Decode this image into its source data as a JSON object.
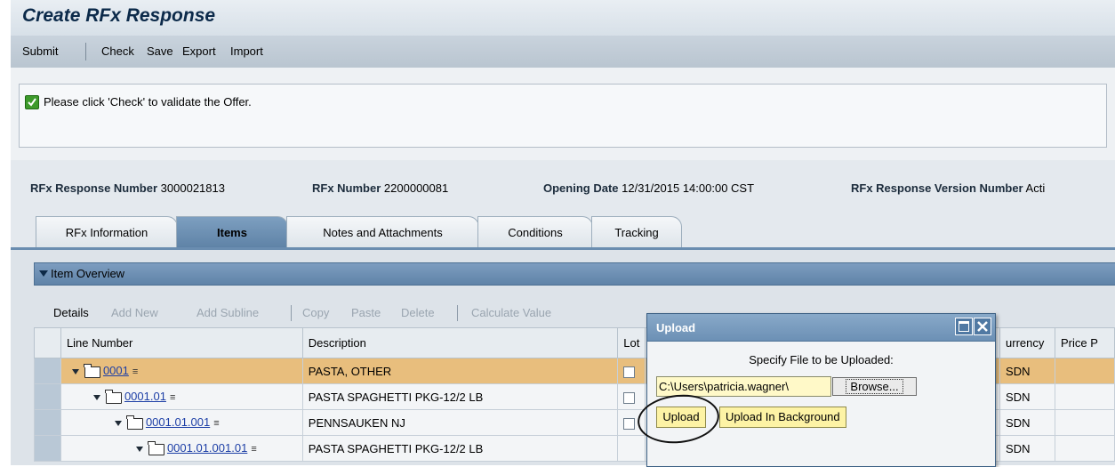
{
  "page_title": "Create RFx Response",
  "toolbar": {
    "submit": "Submit",
    "check": "Check",
    "save": "Save",
    "export": "Export",
    "import": "Import"
  },
  "message": "Please click 'Check' to validate the Offer.",
  "header": {
    "rfx_response_number_label": "RFx Response Number",
    "rfx_response_number": "3000021813",
    "rfx_number_label": "RFx Number",
    "rfx_number": "2200000081",
    "opening_date_label": "Opening Date",
    "opening_date": "12/31/2015 14:00:00 CST",
    "version_label": "RFx Response Version Number",
    "version_value": "Acti"
  },
  "tabs": [
    {
      "label": "RFx Information"
    },
    {
      "label": "Items"
    },
    {
      "label": "Notes and Attachments"
    },
    {
      "label": "Conditions"
    },
    {
      "label": "Tracking"
    }
  ],
  "item_overview": "Item Overview",
  "table_toolbar": {
    "details": "Details",
    "add_new": "Add New",
    "add_subline": "Add Subline",
    "copy": "Copy",
    "paste": "Paste",
    "delete": "Delete",
    "calculate_value": "Calculate Value"
  },
  "columns": {
    "line_number": "Line Number",
    "description": "Description",
    "lot": "Lot",
    "currency": "urrency",
    "price": "Price P"
  },
  "rows": [
    {
      "line": "0001",
      "description": "PASTA, OTHER",
      "currency": "SDN"
    },
    {
      "line": "0001.01",
      "description": "PASTA SPAGHETTI PKG-12/2 LB",
      "currency": "SDN"
    },
    {
      "line": "0001.01.001",
      "description": "PENNSAUKEN NJ",
      "currency": "SDN"
    },
    {
      "line": "0001.01.001.01",
      "description": "PASTA SPAGHETTI PKG-12/2 LB",
      "currency": "SDN"
    }
  ],
  "upload_dialog": {
    "title": "Upload",
    "instruction": "Specify File to be Uploaded:",
    "path_value": "C:\\Users\\patricia.wagner\\",
    "browse": "Browse...",
    "upload": "Upload",
    "upload_background": "Upload In Background"
  },
  "colors": {
    "highlight_row": "#e8be7d",
    "tab_active": "#6a8db0",
    "button_yellow": "#fdf3a5"
  }
}
